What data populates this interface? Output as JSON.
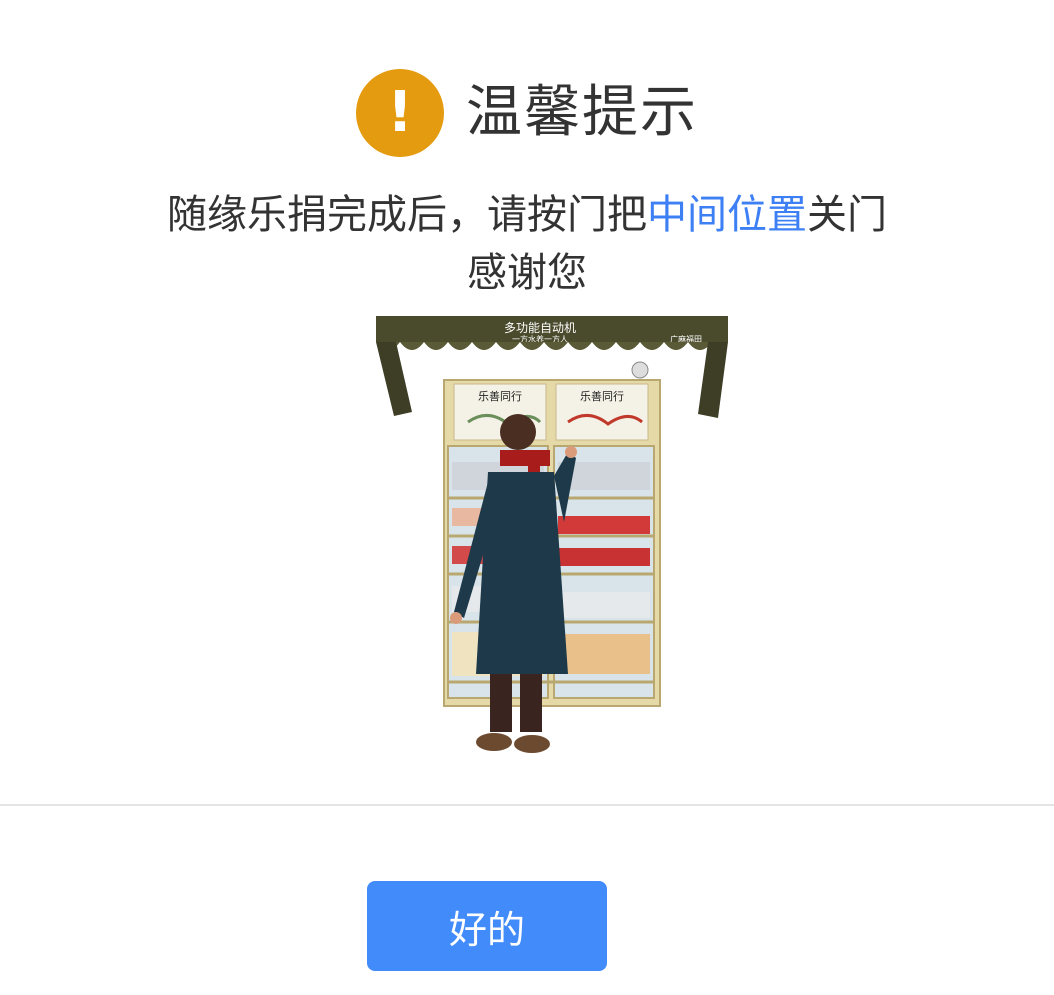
{
  "dialog": {
    "icon": "exclamation-icon",
    "title": "温馨提示",
    "message": {
      "line1_before": "随缘乐捐完成后，请按门把",
      "line1_highlight": "中间位置",
      "line1_after": "关门",
      "line2": "感谢您"
    },
    "illustration": {
      "machine_title": "多功能自动机",
      "machine_subtitle": "一方水养一方人",
      "machine_brand": "广麻福田",
      "panel_label": "乐善同行"
    },
    "ok_label": "好的"
  },
  "colors": {
    "warning": "#e49b0f",
    "highlight": "#3d7ff4",
    "button": "#428bfa",
    "text": "#333333"
  }
}
